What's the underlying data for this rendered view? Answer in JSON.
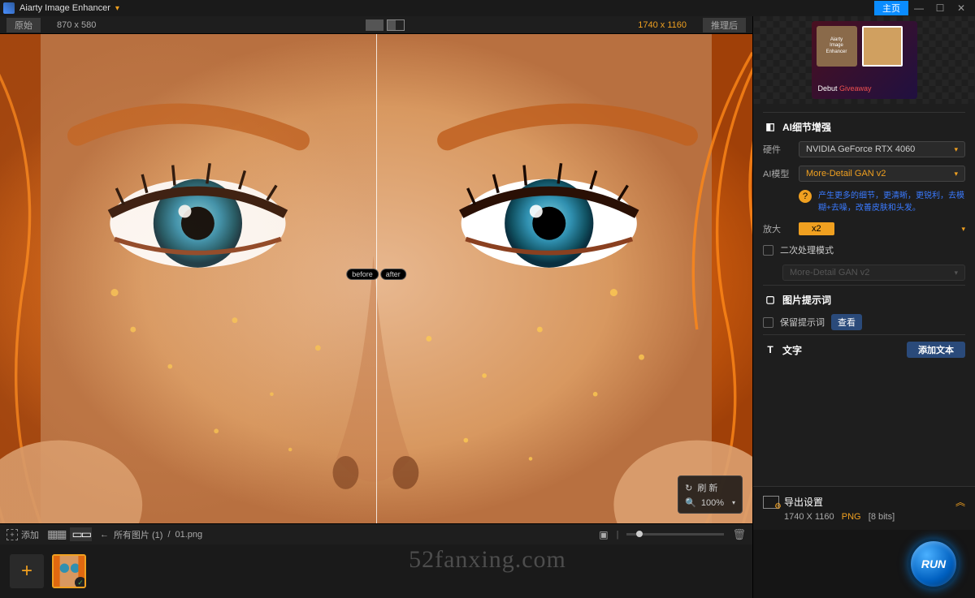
{
  "titlebar": {
    "appname": "Aiarty Image Enhancer",
    "home": "主页"
  },
  "infobar": {
    "orig_label": "原始",
    "orig_dim": "870 x 580",
    "out_dim": "1740 x 1160",
    "after_label": "推理后"
  },
  "split": {
    "before": "before",
    "after": "after"
  },
  "vp_tools": {
    "refresh": "刷 新",
    "zoom": "100%"
  },
  "toolbar": {
    "add": "添加",
    "back_arrow": "←",
    "breadcrumb_folder": "所有图片 (1)",
    "breadcrumb_file": "01.png"
  },
  "promo": {
    "prod_l1": "Aiarty",
    "prod_l2": "Image",
    "prod_l3": "Enhancer",
    "debut": "Debut ",
    "give": "Giveaway"
  },
  "panel": {
    "section_detail": "AI细节增强",
    "hw_label": "硬件",
    "hw_value": "NVIDIA GeForce RTX 4060",
    "model_label": "AI模型",
    "model_value": "More-Detail GAN v2",
    "model_desc": "产生更多的细节，更清晰，更锐利，去模糊+去噪，改善皮肤和头发。",
    "zoom_label": "放大",
    "zoom_value": "x2",
    "secondary": "二次处理模式",
    "secondary_model": "More-Detail GAN v2",
    "section_prompt": "图片提示词",
    "keep_prompt": "保留提示词",
    "view_btn": "查看",
    "section_text": "文字",
    "add_text": "添加文本"
  },
  "export": {
    "title": "导出设置",
    "dim": "1740 X 1160",
    "fmt": "PNG",
    "bits": "[8 bits]"
  },
  "run": "RUN",
  "watermark": "52fanxing.com"
}
